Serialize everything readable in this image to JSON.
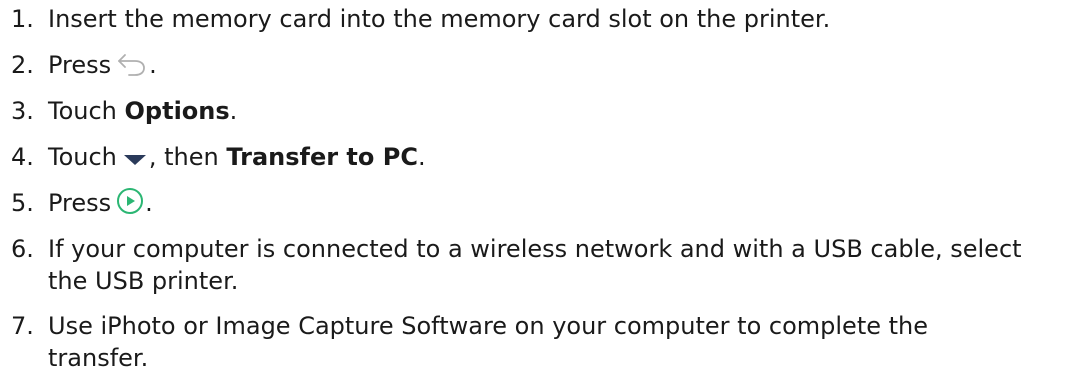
{
  "steps": [
    {
      "number": "1.",
      "text": "Insert the memory card into the memory card slot on the printer."
    },
    {
      "number": "2.",
      "before": "Press",
      "icon": "back-arrow-icon",
      "after": "."
    },
    {
      "number": "3.",
      "before": "Touch ",
      "bold": "Options",
      "after": "."
    },
    {
      "number": "4.",
      "before": "Touch",
      "icon": "down-triangle-icon",
      "middle": ", then ",
      "bold": "Transfer to PC",
      "after": "."
    },
    {
      "number": "5.",
      "before": "Press",
      "icon": "play-button-icon",
      "after": "."
    },
    {
      "number": "6.",
      "line1": "If your computer is connected to a wireless network and with a USB cable, select",
      "line2": "the USB printer."
    },
    {
      "number": "7.",
      "line1": "Use iPhoto or Image Capture Software on your computer to complete the",
      "line2": "transfer."
    }
  ],
  "colors": {
    "text": "#1a1a1a",
    "back_icon": "#b0b0b0",
    "triangle_icon": "#2a3a5a",
    "play_icon": "#2bb673"
  }
}
